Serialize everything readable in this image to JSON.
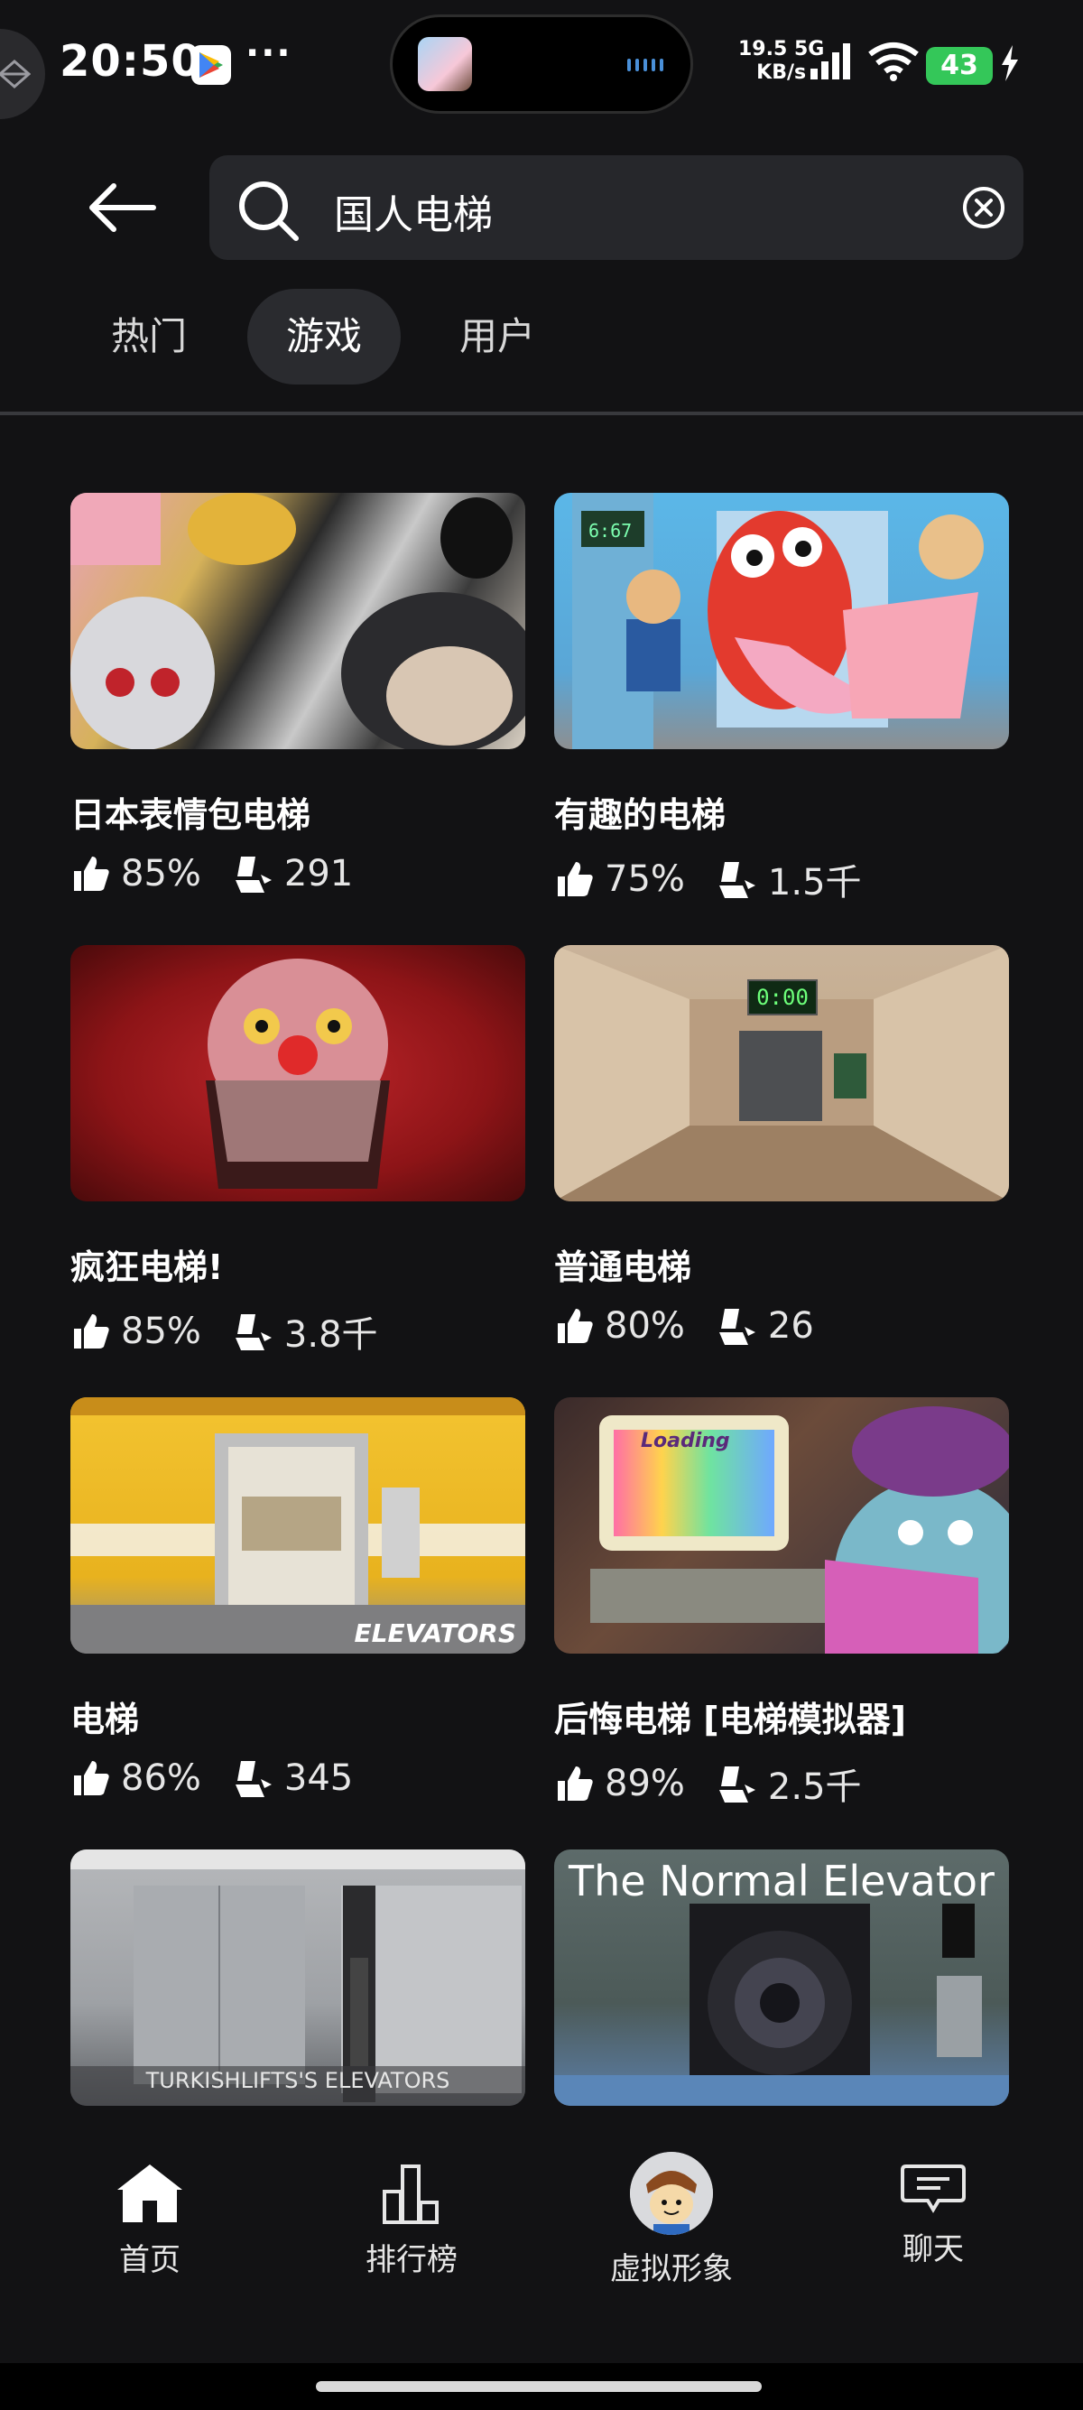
{
  "status_bar": {
    "time": "20:50",
    "more": "···",
    "speed_line1": "19.5 5G",
    "speed_line2": "KB/s",
    "battery": "43"
  },
  "search": {
    "query": "国人电梯"
  },
  "tabs": [
    {
      "label": "热门",
      "active": false
    },
    {
      "label": "游戏",
      "active": true
    },
    {
      "label": "用户",
      "active": false
    }
  ],
  "games": [
    {
      "title": "日本表情包电梯",
      "rating": "85%",
      "players": "291",
      "thumb_text": ""
    },
    {
      "title": "有趣的电梯",
      "rating": "75%",
      "players": "1.5千",
      "thumb_text": "6:67"
    },
    {
      "title": "疯狂电梯!",
      "rating": "85%",
      "players": "3.8千",
      "thumb_text": ""
    },
    {
      "title": "普通电梯",
      "rating": "80%",
      "players": "26",
      "thumb_text": "0:00"
    },
    {
      "title": "电梯",
      "rating": "86%",
      "players": "345",
      "thumb_text": "ELEVATORS"
    },
    {
      "title": "后悔电梯 [电梯模拟器]",
      "rating": "89%",
      "players": "2.5千",
      "thumb_text": "Loading"
    },
    {
      "title": "",
      "rating": "",
      "players": "",
      "thumb_text": "TURKISHLIFTS'S ELEVATORS"
    },
    {
      "title": "",
      "rating": "",
      "players": "",
      "thumb_text": "The Normal Elevator"
    }
  ],
  "bottom_nav": [
    {
      "label": "首页",
      "icon": "home-icon"
    },
    {
      "label": "排行榜",
      "icon": "leaderboard-icon"
    },
    {
      "label": "虚拟形象",
      "icon": "avatar-icon"
    },
    {
      "label": "聊天",
      "icon": "chat-icon"
    }
  ]
}
